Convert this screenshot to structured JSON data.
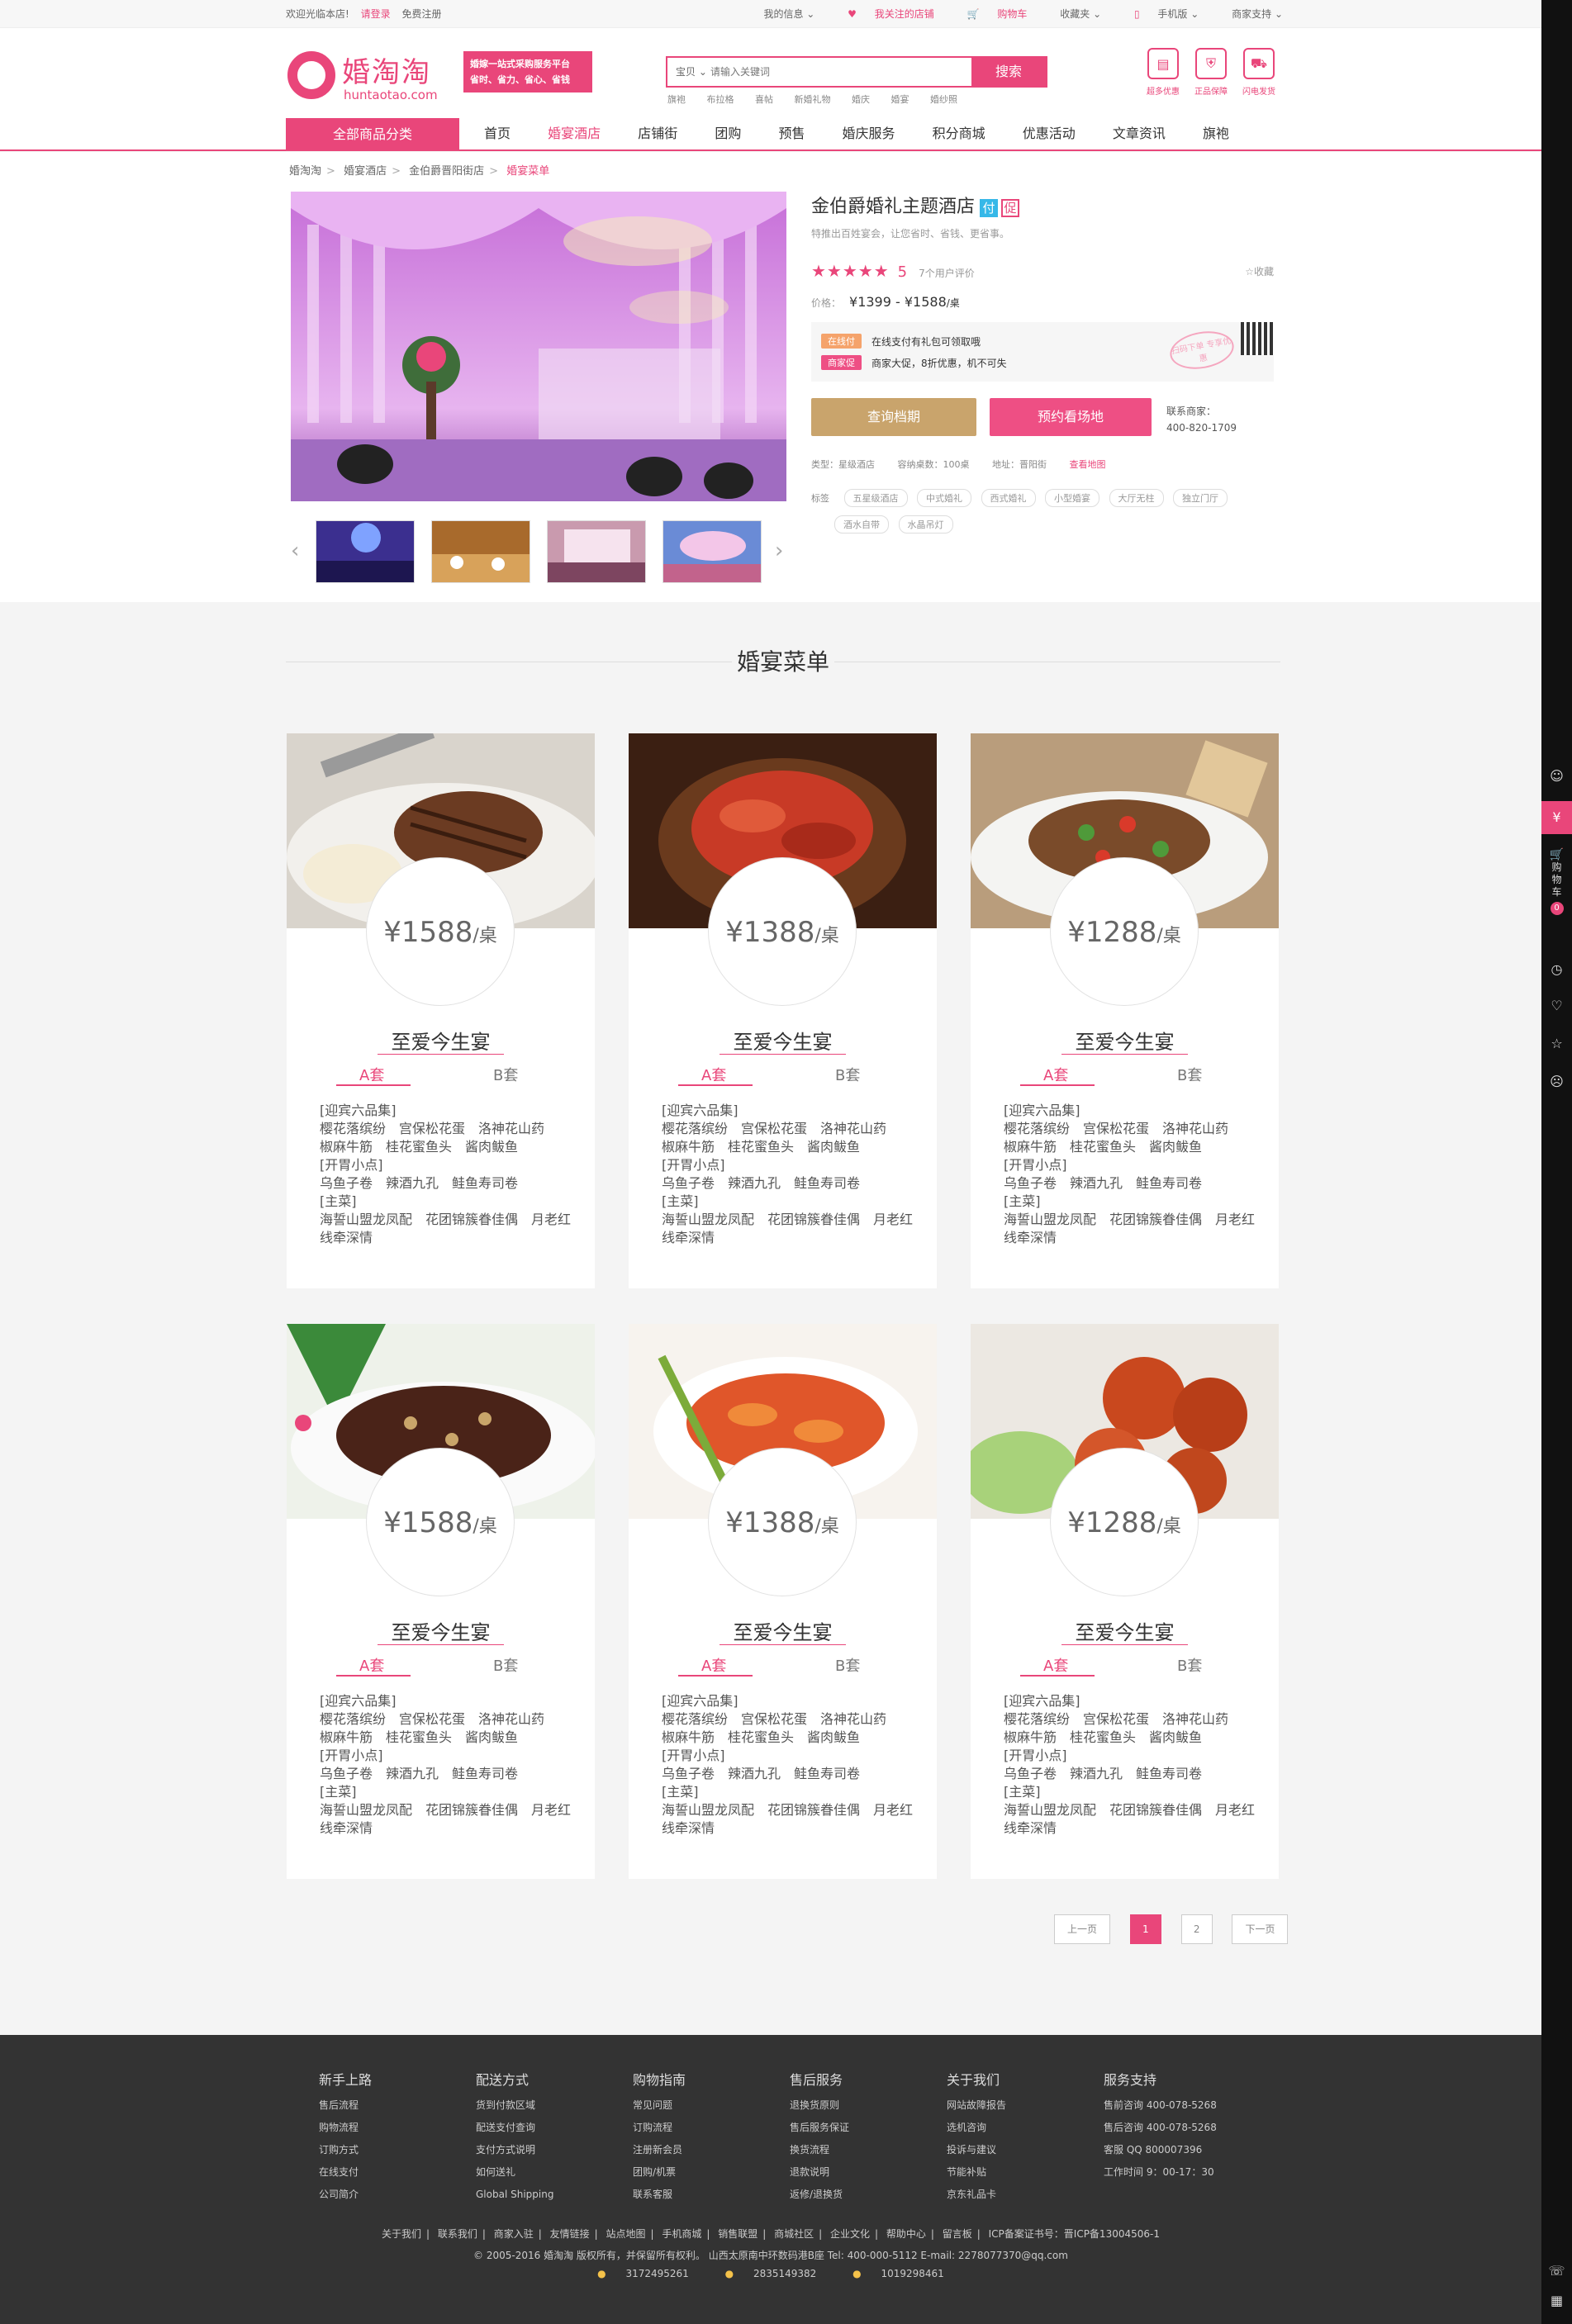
{
  "topbar": {
    "welcome": "欢迎光临本店!",
    "login": "请登录",
    "register": "免费注册",
    "my_info": "我的信息",
    "followed": "我关注的店铺",
    "cart": "购物车",
    "favorites": "收藏夹",
    "mobile": "手机版",
    "seller_support": "商家支持"
  },
  "logo": {
    "cn": "婚淘淘",
    "en": "huntaotao.com"
  },
  "slogan": {
    "line1": "婚嫁一站式采购服务平台",
    "line2": "省时、省力、省心、省钱"
  },
  "search": {
    "category": "宝贝",
    "placeholder": "请输入关键词",
    "button": "搜索",
    "hotwords": [
      "旗袍",
      "布拉格",
      "喜帖",
      "新婚礼物",
      "婚庆",
      "婚宴",
      "婚纱照"
    ]
  },
  "services": [
    {
      "label": "超多优惠",
      "icon": "coupon-icon"
    },
    {
      "label": "正品保障",
      "icon": "shield-icon"
    },
    {
      "label": "闪电发货",
      "icon": "truck-icon"
    }
  ],
  "nav": {
    "all": "全部商品分类",
    "items": [
      "首页",
      "婚宴酒店",
      "店铺街",
      "团购",
      "预售",
      "婚庆服务",
      "积分商城",
      "优惠活动",
      "文章资讯",
      "旗袍"
    ]
  },
  "breadcrumb": [
    "婚淘淘",
    "婚宴酒店",
    "金伯爵晋阳街店",
    "婚宴菜单"
  ],
  "product": {
    "title": "金伯爵婚礼主题酒店",
    "tag_fu": "付",
    "tag_cu": "促",
    "subtitle": "特推出百姓宴会，让您省时、省钱、更省事。",
    "stars": "★★★★★",
    "score": "5",
    "reviews": "7个用户评价",
    "favorite": "收藏",
    "price_label": "价格：",
    "price_range": "¥1399 - ¥1588",
    "price_unit": "/桌",
    "promo1_badge": "在线付",
    "promo1_text": "在线支付有礼包可领取哦",
    "promo2_badge": "商家促",
    "promo2_text": "商家大促，8折优惠，机不可失",
    "stamp": "扫码下单 专享优惠",
    "btn_query": "查询档期",
    "btn_book": "预约看场地",
    "contact_label": "联系商家：",
    "contact_phone": "400-820-1709",
    "type": "类型：星级酒店",
    "tables": "容纳桌数：100桌",
    "address": "地址：晋阳街",
    "map": "查看地图",
    "tags_label": "标签",
    "tags": [
      "五星级酒店",
      "中式婚礼",
      "西式婚礼",
      "小型婚宴",
      "大厅无柱",
      "独立门厅",
      "酒水自带",
      "水晶吊灯"
    ]
  },
  "section_title": "婚宴菜单",
  "cards": [
    {
      "price": "¥1588",
      "unit": "/桌",
      "name": "至爱今生宴",
      "tabA": "A套",
      "tabB": "B套",
      "menu": "[迎宾六品集]\n樱花落缤纷　宫保松花蛋　洛神花山药\n椒麻牛筋　桂花蜜鱼头　酱肉鲅鱼\n[开胃小点]\n乌鱼子卷　辣酒九孔　鲑鱼寿司卷\n[主菜]\n海誓山盟龙凤配　花团锦簇眷佳偶　月老红线牵深情"
    },
    {
      "price": "¥1388",
      "unit": "/桌",
      "name": "至爱今生宴",
      "tabA": "A套",
      "tabB": "B套",
      "menu": "[迎宾六品集]\n樱花落缤纷　宫保松花蛋　洛神花山药\n椒麻牛筋　桂花蜜鱼头　酱肉鲅鱼\n[开胃小点]\n乌鱼子卷　辣酒九孔　鲑鱼寿司卷\n[主菜]\n海誓山盟龙凤配　花团锦簇眷佳偶　月老红线牵深情"
    },
    {
      "price": "¥1288",
      "unit": "/桌",
      "name": "至爱今生宴",
      "tabA": "A套",
      "tabB": "B套",
      "menu": "[迎宾六品集]\n樱花落缤纷　宫保松花蛋　洛神花山药\n椒麻牛筋　桂花蜜鱼头　酱肉鲅鱼\n[开胃小点]\n乌鱼子卷　辣酒九孔　鲑鱼寿司卷\n[主菜]\n海誓山盟龙凤配　花团锦簇眷佳偶　月老红线牵深情"
    },
    {
      "price": "¥1588",
      "unit": "/桌",
      "name": "至爱今生宴",
      "tabA": "A套",
      "tabB": "B套",
      "menu": "[迎宾六品集]\n樱花落缤纷　宫保松花蛋　洛神花山药\n椒麻牛筋　桂花蜜鱼头　酱肉鲅鱼\n[开胃小点]\n乌鱼子卷　辣酒九孔　鲑鱼寿司卷\n[主菜]\n海誓山盟龙凤配　花团锦簇眷佳偶　月老红线牵深情"
    },
    {
      "price": "¥1388",
      "unit": "/桌",
      "name": "至爱今生宴",
      "tabA": "A套",
      "tabB": "B套",
      "menu": "[迎宾六品集]\n樱花落缤纷　宫保松花蛋　洛神花山药\n椒麻牛筋　桂花蜜鱼头　酱肉鲅鱼\n[开胃小点]\n乌鱼子卷　辣酒九孔　鲑鱼寿司卷\n[主菜]\n海誓山盟龙凤配　花团锦簇眷佳偶　月老红线牵深情"
    },
    {
      "price": "¥1288",
      "unit": "/桌",
      "name": "至爱今生宴",
      "tabA": "A套",
      "tabB": "B套",
      "menu": "[迎宾六品集]\n樱花落缤纷　宫保松花蛋　洛神花山药\n椒麻牛筋　桂花蜜鱼头　酱肉鲅鱼\n[开胃小点]\n乌鱼子卷　辣酒九孔　鲑鱼寿司卷\n[主菜]\n海誓山盟龙凤配　花团锦簇眷佳偶　月老红线牵深情"
    }
  ],
  "pager": {
    "prev": "上一页",
    "p1": "1",
    "p2": "2",
    "next": "下一页"
  },
  "footer": {
    "cols": [
      {
        "title": "新手上路",
        "items": [
          "售后流程",
          "购物流程",
          "订购方式",
          "在线支付",
          "公司简介"
        ]
      },
      {
        "title": "配送方式",
        "items": [
          "货到付款区域",
          "配送支付查询",
          "支付方式说明",
          "如何送礼",
          "Global Shipping"
        ]
      },
      {
        "title": "购物指南",
        "items": [
          "常见问题",
          "订购流程",
          "注册新会员",
          "团购/机票",
          "联系客服"
        ]
      },
      {
        "title": "售后服务",
        "items": [
          "退换货原则",
          "售后服务保证",
          "换货流程",
          "退款说明",
          "返修/退换货"
        ]
      },
      {
        "title": "关于我们",
        "items": [
          "网站故障报告",
          "选机咨询",
          "投诉与建议",
          "节能补贴",
          "京东礼品卡"
        ]
      },
      {
        "title": "服务支持",
        "items": [
          "售前咨询 400-078-5268",
          "售后咨询 400-078-5268",
          "客服 QQ 800007396",
          "工作时间 9：00-17：30"
        ]
      }
    ],
    "links": [
      "关于我们",
      "联系我们",
      "商家入驻",
      "友情链接",
      "站点地图",
      "手机商城",
      "销售联盟",
      "商城社区",
      "企业文化",
      "帮助中心",
      "留言板",
      "ICP备案证书号：晋ICP备13004506-1"
    ],
    "copyright": "© 2005-2016 婚淘淘 版权所有，并保留所有权利。 山西太原南中环数码港B座 Tel: 400-000-5112 E-mail: 2278077370@qq.com",
    "qq": [
      "3172495261",
      "2835149382",
      "1019298461"
    ]
  },
  "sidebar": {
    "cart_label": "购物车",
    "cart_count": "0"
  },
  "colors": {
    "brand": "#e9467a",
    "gold": "#c9a46c",
    "footer_bg": "#333333"
  }
}
